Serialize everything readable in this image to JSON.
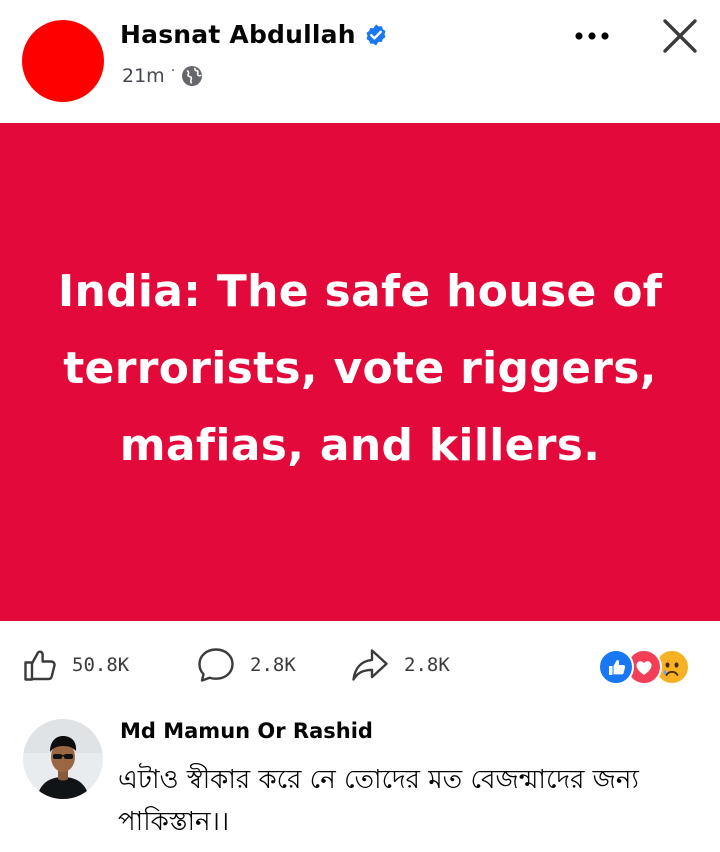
{
  "post": {
    "author_name": "Hasnat Abdullah",
    "time": "21m",
    "separator": "·",
    "icons": {
      "verified": "verified-badge-icon",
      "audience": "globe-icon",
      "more": "more-options-icon",
      "close": "close-icon"
    }
  },
  "banner": {
    "text": "India: The safe house of terrorists, vote riggers, mafias, and killers.",
    "background_color": "#e3093a",
    "text_color": "#ffffff"
  },
  "stats": {
    "likes": "50.8K",
    "comments": "2.8K",
    "shares": "2.8K",
    "reaction_icons": [
      "like-reaction-icon",
      "love-reaction-icon",
      "sad-reaction-icon"
    ]
  },
  "comment": {
    "author_name": "Md Mamun Or Rashid",
    "text": "এটাও স্বীকার করে নে তোদের মত বেজন্মাদের জন্য পাকিস্তান।।"
  },
  "colors": {
    "accent_blue": "#1877f2",
    "avatar_red": "#ff0000",
    "text_primary": "#050505",
    "text_secondary": "#444950"
  }
}
